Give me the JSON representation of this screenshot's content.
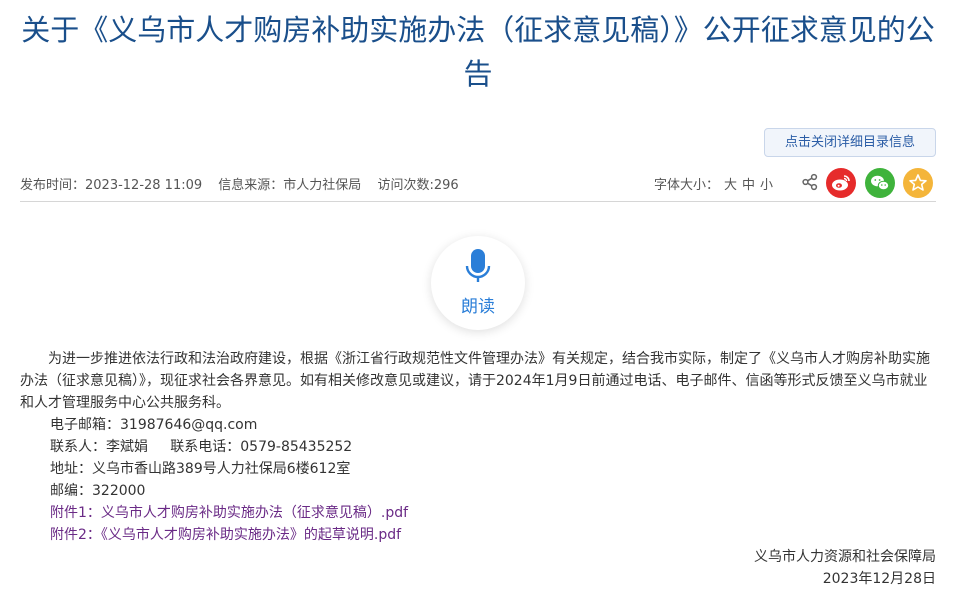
{
  "article": {
    "title": "关于《义乌市人才购房补助实施办法（征求意见稿）》公开征求意见的公告"
  },
  "toolbar": {
    "directory_button": "点击关闭详细目录信息"
  },
  "meta": {
    "publish_time": "发布时间：2023-12-28 11:09",
    "source": "信息来源：市人力社保局",
    "visits": "访问次数:296",
    "font_size_label": "字体大小：",
    "font_large": "大",
    "font_medium": "中",
    "font_small": "小"
  },
  "icons": {
    "share": "share-icon",
    "weibo": "weibo-icon",
    "wechat": "wechat-icon",
    "favorite": "star-icon",
    "microphone": "microphone-icon"
  },
  "colors": {
    "title": "#1a4f8b",
    "weibo": "#e62b2b",
    "wechat": "#3fb33c",
    "favorite": "#f4b53a",
    "read_accent": "#2a7ed8",
    "attachment_link": "#6a2a86"
  },
  "read_aloud": {
    "label": "朗读"
  },
  "body": {
    "paragraph": "为进一步推进依法行政和法治政府建设，根据《浙江省行政规范性文件管理办法》有关规定，结合我市实际，制定了《义乌市人才购房补助实施办法（征求意见稿）》，现征求社会各界意见。如有相关修改意见或建议，请于2024年1月9日前通过电话、电子邮件、信函等形式反馈至义乌市就业和人才管理服务中心公共服务科。",
    "email": "电子邮箱：31987646@qq.com",
    "contact_person": "联系人：李斌娟",
    "contact_phone": "联系电话：0579-85435252",
    "address": "地址：义乌市香山路389号人力社保局6楼612室",
    "postcode": "邮编：322000",
    "attachment_1": "附件1：义乌市人才购房补助实施办法（征求意见稿）.pdf",
    "attachment_2": "附件2：《义乌市人才购房补助实施办法》的起草说明.pdf"
  },
  "signature": {
    "org": "义乌市人力资源和社会保障局",
    "date": "2023年12月28日"
  }
}
